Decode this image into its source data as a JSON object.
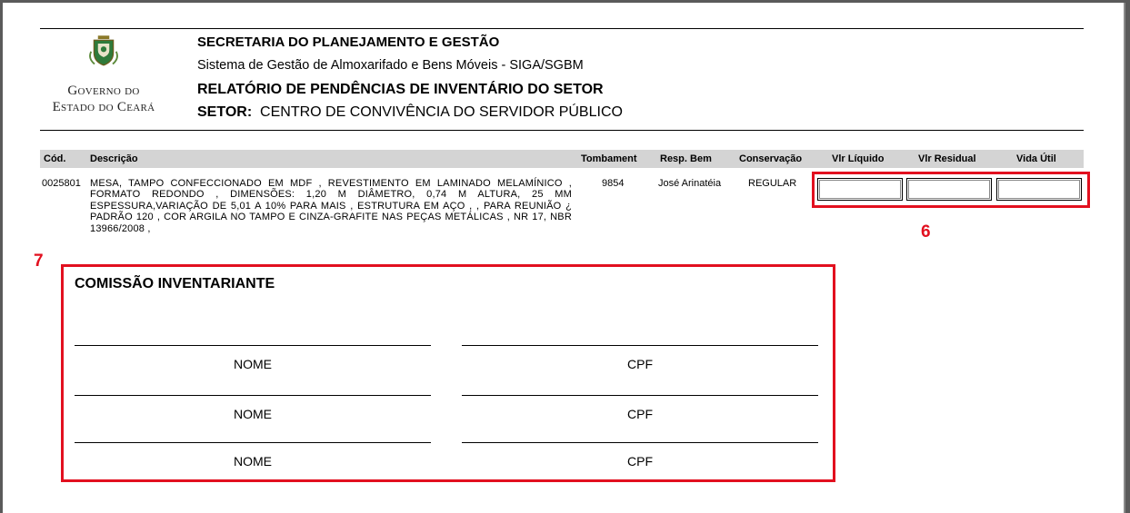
{
  "header": {
    "gov_line1": "Governo do",
    "gov_line2": "Estado do Ceará",
    "org": "SECRETARIA DO PLANEJAMENTO E GESTÃO",
    "system": "Sistema de Gestão de Almoxarifado e Bens Móveis - SIGA/SGBM",
    "report_title": "RELATÓRIO DE PENDÊNCIAS DE INVENTÁRIO DO SETOR",
    "sector_label": "SETOR:",
    "sector_value": "CENTRO DE CONVIVÊNCIA DO SERVIDOR PÚBLICO"
  },
  "table": {
    "columns": [
      "Cód.",
      "Descrição",
      "Tombament",
      "Resp. Bem",
      "Conservação",
      "Vlr Líquido",
      "Vlr Residual",
      "Vida Útil"
    ],
    "rows": [
      {
        "code": "0025801",
        "description": "MESA, TAMPO CONFECCIONADO EM MDF , REVESTIMENTO EM LAMINADO MELAMÍNICO , FORMATO REDONDO , DIMENSÕES: 1,20 M DIÂMETRO, 0,74 M ALTURA, 25 MM ESPESSURA,VARIAÇÃO DE 5,01 A 10% PARA MAIS , ESTRUTURA EM AÇO , , PARA REUNIÃO ¿ PADRÃO 120 , COR ARGILA NO TAMPO E CINZA-GRAFITE NAS PEÇAS METÁLICAS , NR 17, NBR 13966/2008 ,",
        "tombamento": "9854",
        "resp": "José Arinatéia",
        "conservacao": "REGULAR",
        "vlr_liquido": "",
        "vlr_residual": "",
        "vida_util": ""
      }
    ]
  },
  "annotations": {
    "label6": "6",
    "label7": "7",
    "color": "#e2101f"
  },
  "commission": {
    "title": "COMISSÃO INVENTARIANTE",
    "name_label": "NOME",
    "cpf_label": "CPF"
  }
}
